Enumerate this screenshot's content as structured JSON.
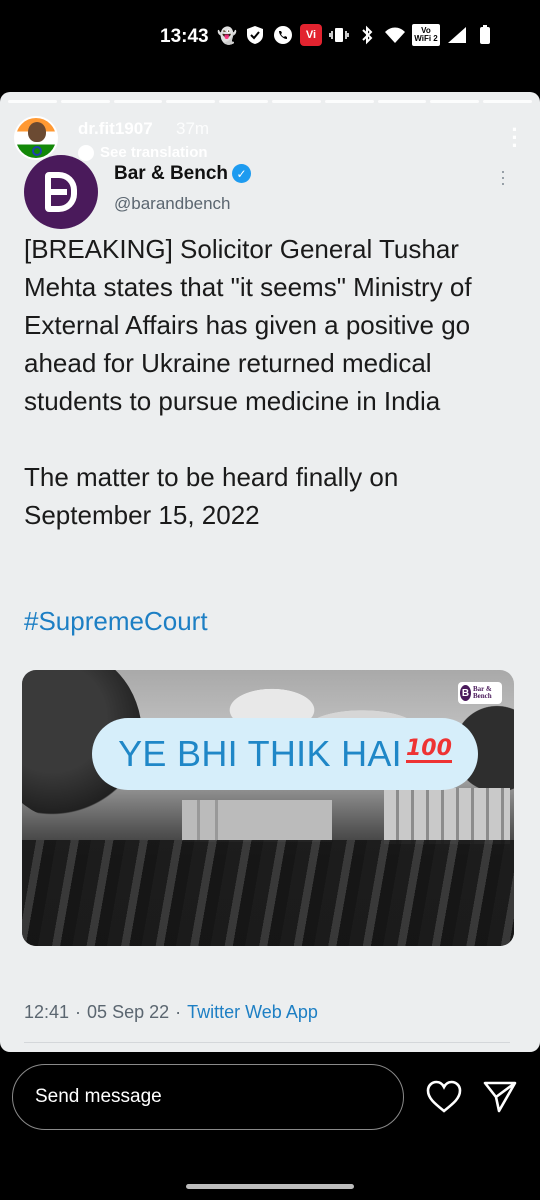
{
  "status_bar": {
    "time": "13:43",
    "icons": [
      "snapchat-icon",
      "shield-icon",
      "phone-icon",
      "vi-app-icon",
      "vibrate-icon",
      "bluetooth-icon",
      "wifi-icon",
      "vowifi-icon",
      "signal-icon",
      "battery-icon"
    ],
    "vi_label": "Vi",
    "vowifi_label_top": "Vo",
    "vowifi_label_bottom": "WiFi 2"
  },
  "story": {
    "username": "dr.fit1907",
    "time_ago": "37m",
    "see_translation": "See translation",
    "segments": 10
  },
  "tweet": {
    "name": "Bar & Bench",
    "handle": "@barandbench",
    "verified": true,
    "text": "[BREAKING] Solicitor General Tushar Mehta states that \"it seems\" Ministry of External Affairs has given a positive go ahead for Ukraine returned medical students to pursue medicine in India\n\nThe matter to be heard finally on September 15, 2022",
    "hashtag": "#SupremeCourt",
    "image_logo_letter": "B",
    "image_logo_text": "Bar & Bench",
    "time": "12:41",
    "date": "05 Sep 22",
    "source": "Twitter Web App",
    "separator": "·",
    "colors": {
      "link": "#1d7fc4",
      "brand": "#4a1a5b",
      "verified": "#1d9bf0"
    }
  },
  "sticker": {
    "text": "YE BHI THIK HAI",
    "emoji": "100",
    "color": "#1f87c7",
    "background": "#d6eefa"
  },
  "bottom_bar": {
    "message_placeholder": "Send message"
  }
}
